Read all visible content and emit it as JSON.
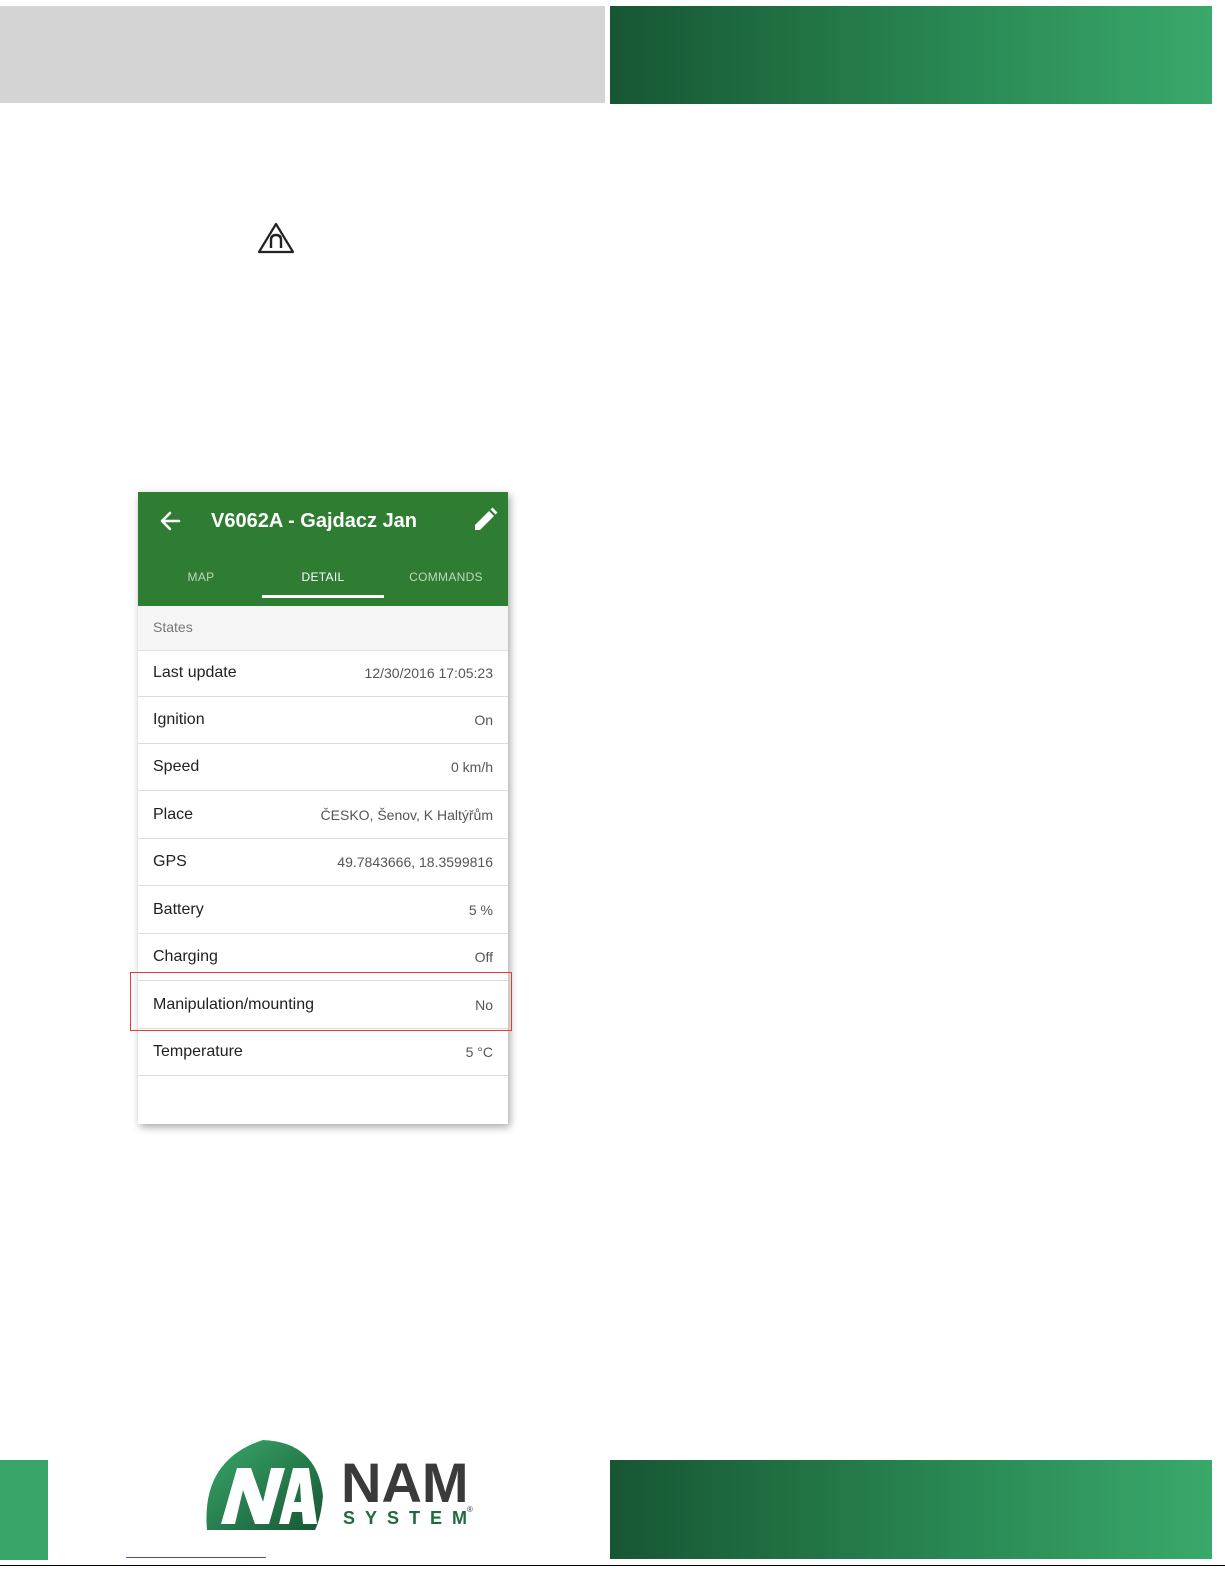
{
  "app": {
    "title": "V6062A - Gajdacz Jan",
    "tabs": [
      {
        "label": "MAP",
        "active": false
      },
      {
        "label": "DETAIL",
        "active": true
      },
      {
        "label": "COMMANDS",
        "active": false
      }
    ],
    "section_title": "States",
    "rows": [
      {
        "label": "Last update",
        "value": "12/30/2016 17:05:23"
      },
      {
        "label": "Ignition",
        "value": "On"
      },
      {
        "label": "Speed",
        "value": "0 km/h"
      },
      {
        "label": "Place",
        "value": "ČESKO, Šenov, K Haltýřům"
      },
      {
        "label": "GPS",
        "value": "49.7843666, 18.3599816"
      },
      {
        "label": "Battery",
        "value": "5 %"
      },
      {
        "label": "Charging",
        "value": "Off"
      },
      {
        "label": "Manipulation/mounting",
        "value": "No"
      },
      {
        "label": "Temperature",
        "value": "5 °C"
      }
    ]
  },
  "logo": {
    "name": "NAM",
    "sub": "SYSTEM",
    "mark": "®"
  },
  "colors": {
    "appbar": "#2e7d32",
    "brand_dark": "#175633",
    "brand_light": "#39a96b",
    "highlight": "#e53935"
  },
  "icons": {
    "warning": "warning-triangle-icon",
    "back": "arrow-left-icon",
    "edit": "pencil-icon"
  }
}
